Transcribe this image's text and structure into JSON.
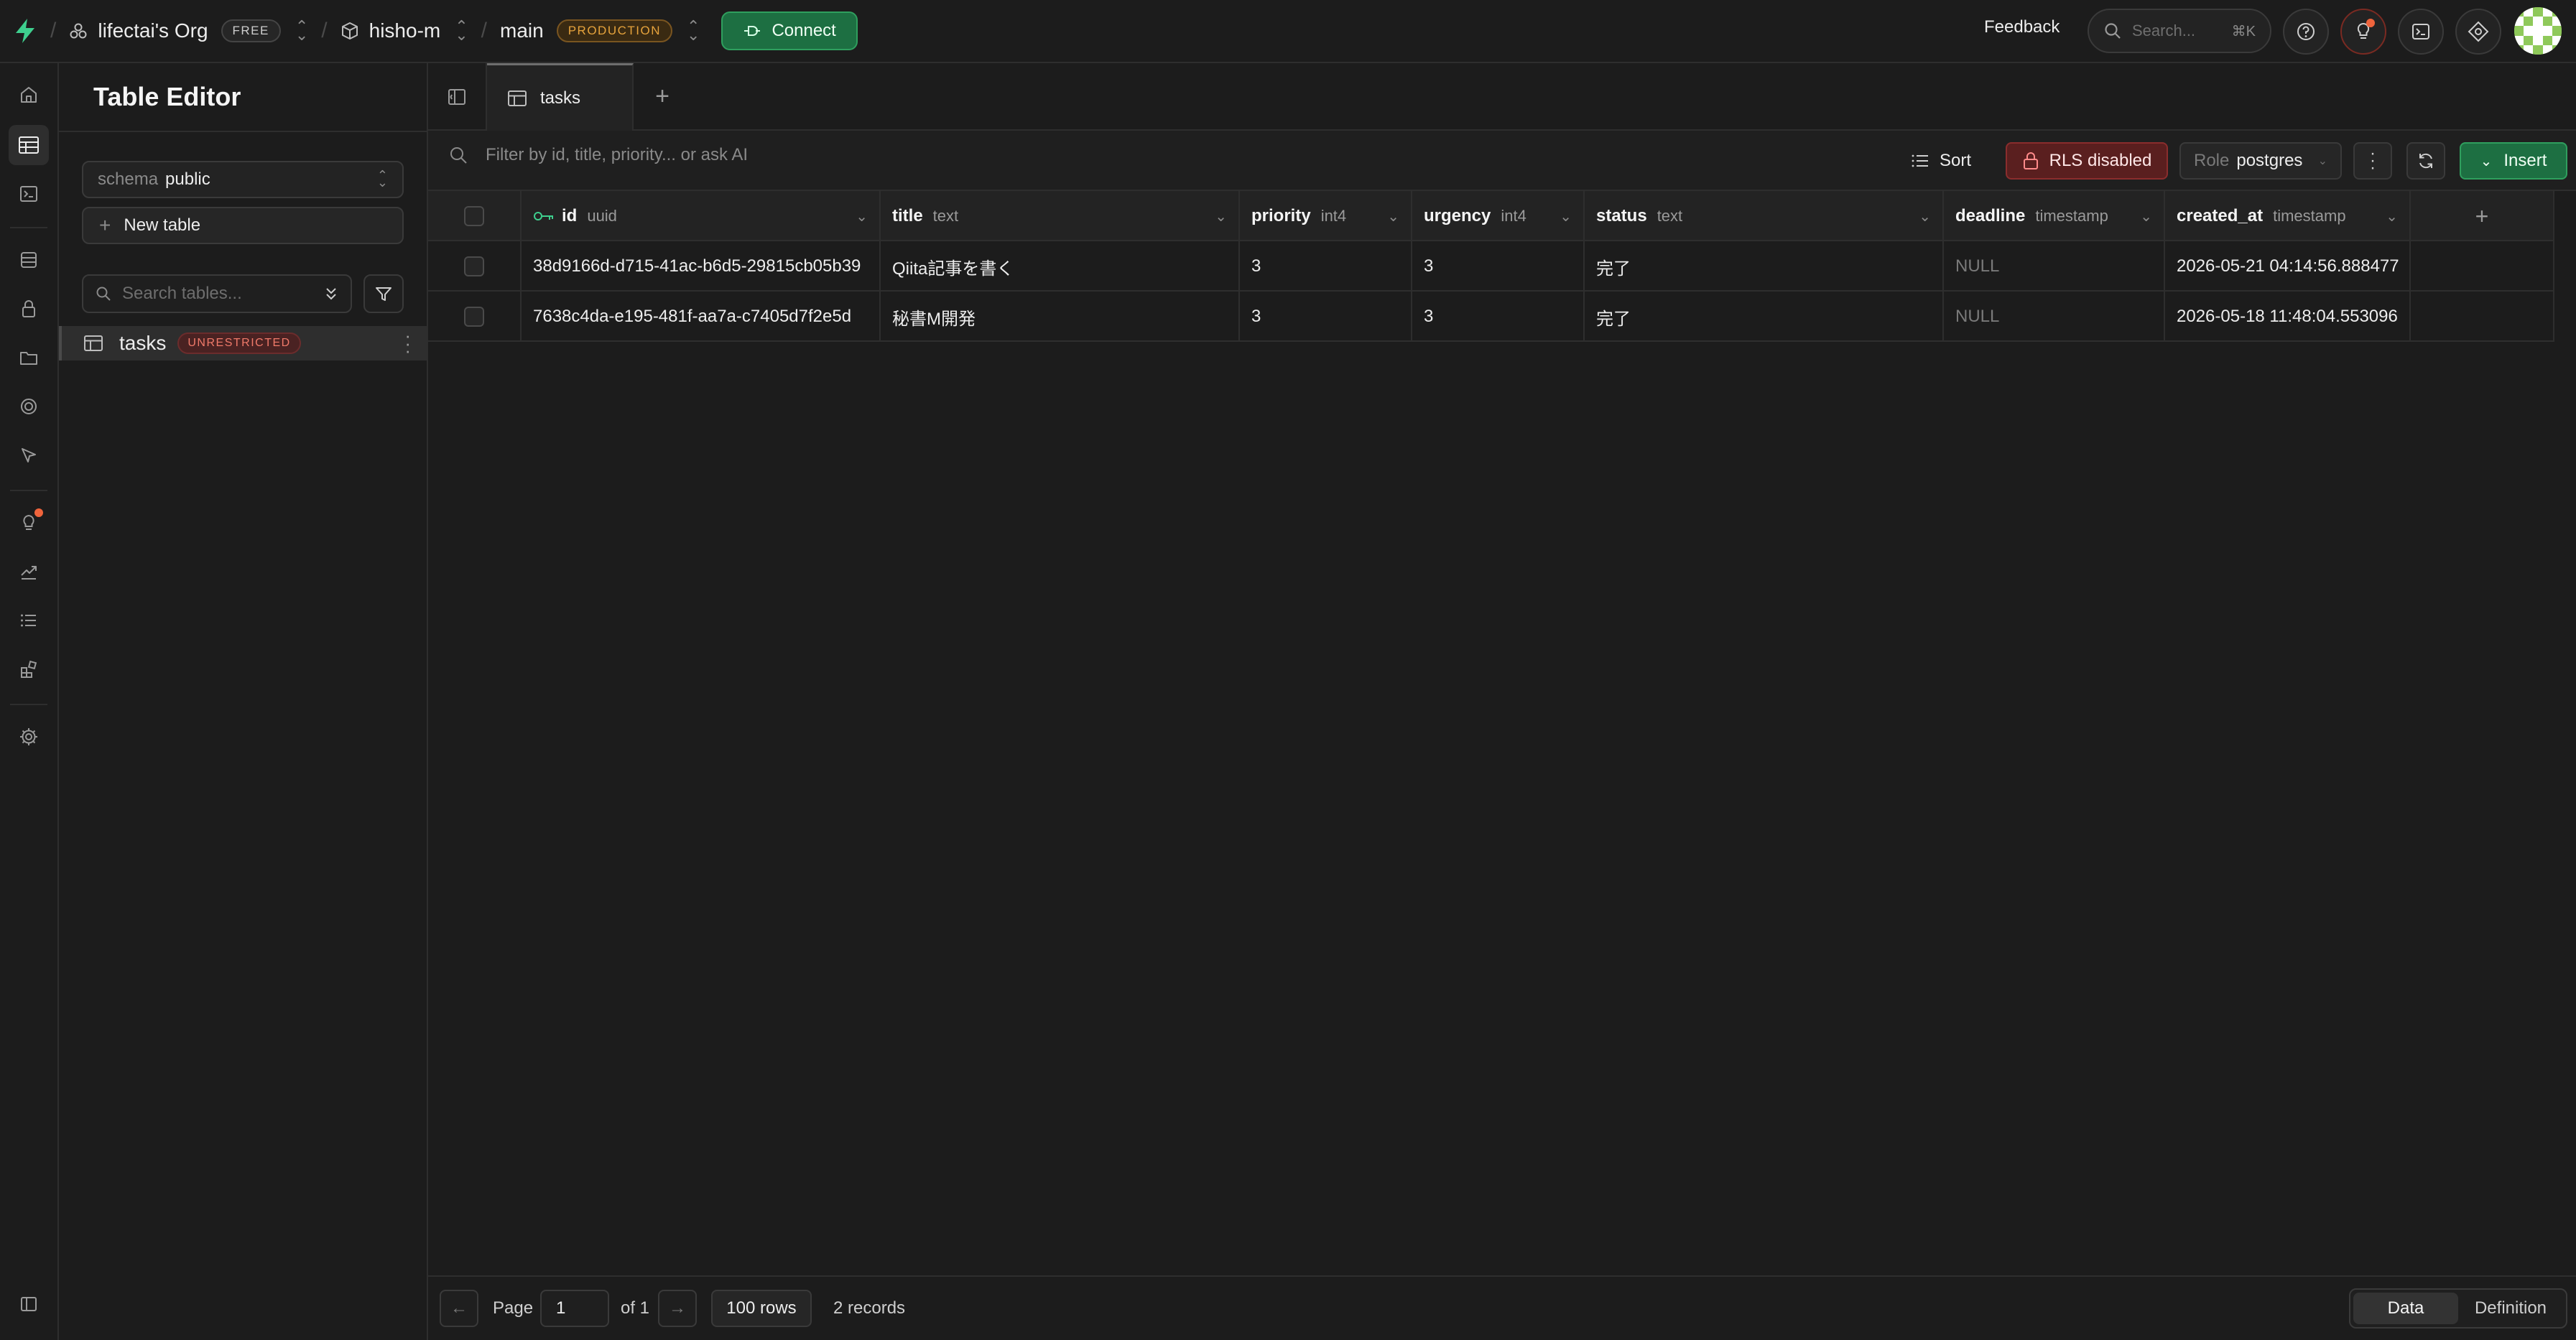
{
  "topbar": {
    "org_name": "lifectai's Org",
    "org_plan": "FREE",
    "project_name": "hisho-m",
    "branch_name": "main",
    "branch_env": "PRODUCTION",
    "connect_label": "Connect",
    "feedback_label": "Feedback",
    "search_placeholder": "Search...",
    "search_shortcut": "⌘K",
    "icons": [
      "help-icon",
      "tips-icon",
      "terminal-icon",
      "ai-assistant-icon",
      "avatar"
    ]
  },
  "rail": {
    "items": [
      "home-icon",
      "table-editor-icon",
      "sql-editor-icon",
      "database-icon",
      "auth-icon",
      "storage-icon",
      "edge-functions-icon",
      "realtime-icon",
      "advisors-icon",
      "reports-icon",
      "logs-icon",
      "integrations-icon",
      "settings-icon"
    ],
    "active": "table-editor-icon"
  },
  "sidebar": {
    "title": "Table Editor",
    "schema_label": "schema",
    "schema_value": "public",
    "new_table_label": "New table",
    "search_placeholder": "Search tables...",
    "tables": [
      {
        "name": "tasks",
        "badge": "UNRESTRICTED"
      }
    ]
  },
  "tabs": [
    {
      "label": "tasks"
    }
  ],
  "toolbar": {
    "filter_placeholder": "Filter by id, title, priority... or ask AI",
    "sort_label": "Sort",
    "rls_label": "RLS disabled",
    "role_label": "Role",
    "role_value": "postgres",
    "insert_label": "Insert"
  },
  "grid": {
    "columns": [
      {
        "name": "id",
        "type": "uuid",
        "primary_key": true
      },
      {
        "name": "title",
        "type": "text"
      },
      {
        "name": "priority",
        "type": "int4"
      },
      {
        "name": "urgency",
        "type": "int4"
      },
      {
        "name": "status",
        "type": "text"
      },
      {
        "name": "deadline",
        "type": "timestamp"
      },
      {
        "name": "created_at",
        "type": "timestamp"
      }
    ],
    "rows": [
      [
        "38d9166d-d715-41ac-b6d5-29815cb05b39",
        "Qiita記事を書く",
        "3",
        "3",
        "完了",
        "NULL",
        "2026-05-21 04:14:56.888477"
      ],
      [
        "7638c4da-e195-481f-aa7a-c7405d7f2e5d",
        "秘書M開発",
        "3",
        "3",
        "完了",
        "NULL",
        "2026-05-18 11:48:04.553096"
      ]
    ]
  },
  "footer": {
    "page_label": "Page",
    "page_value": "1",
    "of_label": "of 1",
    "rows_label": "100 rows",
    "records_label": "2 records",
    "view_data": "Data",
    "view_definition": "Definition"
  },
  "colors": {
    "accent_green": "#1d6f42",
    "danger_red": "#5a1f1f",
    "production_orange": "#e6a33c"
  }
}
